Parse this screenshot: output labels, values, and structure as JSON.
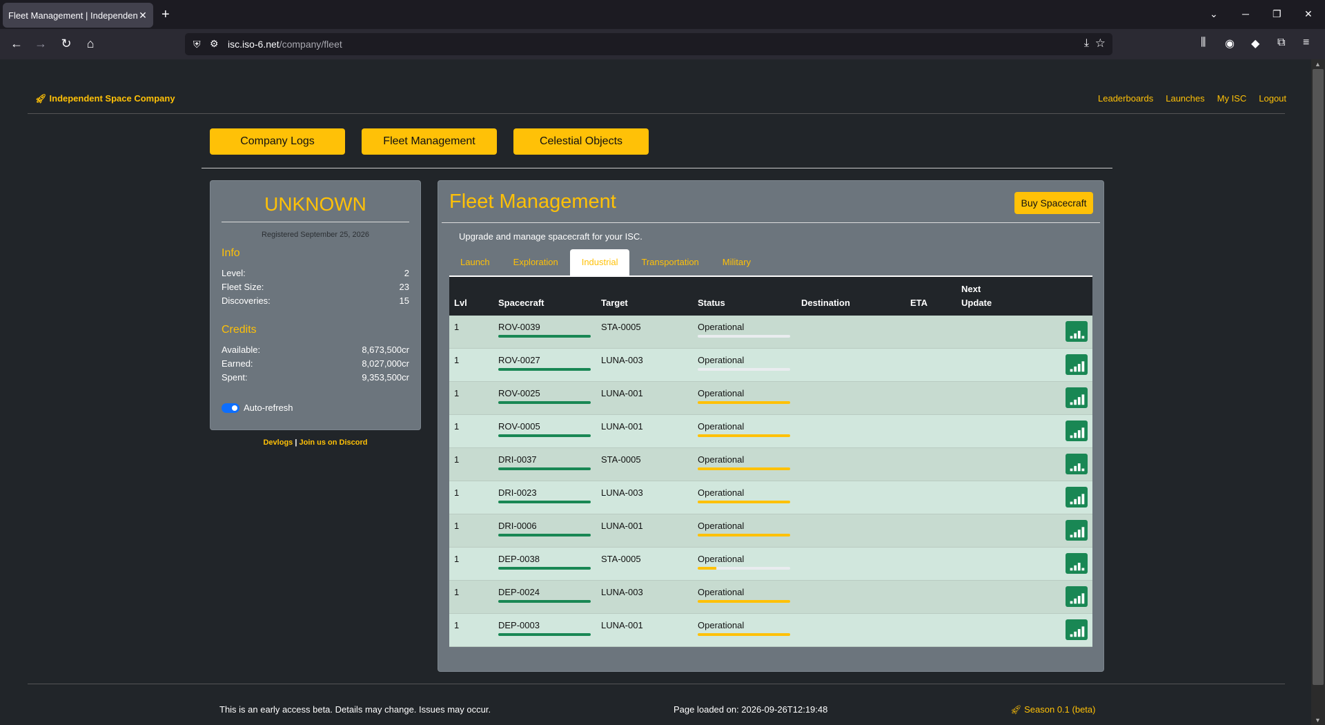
{
  "browser": {
    "tab_title": "Fleet Management | Independent Space Company",
    "tab_close": "✕",
    "new_tab": "+",
    "url_host": "isc.iso-6.net",
    "url_path": "/company/fleet"
  },
  "header": {
    "brand": "Independent Space Company",
    "nav": [
      "Leaderboards",
      "Launches",
      "My ISC",
      "Logout"
    ]
  },
  "section_nav": [
    "Company Logs",
    "Fleet Management",
    "Celestial Objects"
  ],
  "profile": {
    "name": "UNKNOWN",
    "registered": "Registered September 25, 2026",
    "info_title": "Info",
    "info": [
      {
        "label": "Level:",
        "value": "2"
      },
      {
        "label": "Fleet Size:",
        "value": "23"
      },
      {
        "label": "Discoveries:",
        "value": "15"
      }
    ],
    "credits_title": "Credits",
    "credits": [
      {
        "label": "Available:",
        "value": "8,673,500cr"
      },
      {
        "label": "Earned:",
        "value": "8,027,000cr"
      },
      {
        "label": "Spent:",
        "value": "9,353,500cr"
      }
    ],
    "auto_refresh_label": "Auto-refresh",
    "auto_refresh_on": true,
    "link_devlogs": "Devlogs",
    "link_sep": " | ",
    "link_discord": "Join us on Discord"
  },
  "fleet": {
    "title": "Fleet Management",
    "buy_label": "Buy Spacecraft",
    "description": "Upgrade and manage spacecraft for your ISC.",
    "tabs": [
      "Launch",
      "Exploration",
      "Industrial",
      "Transportation",
      "Military"
    ],
    "active_tab": "Industrial",
    "columns": {
      "lvl": "Lvl",
      "spacecraft": "Spacecraft",
      "target": "Target",
      "status": "Status",
      "destination": "Destination",
      "eta": "ETA",
      "next_update_1": "Next",
      "next_update_2": "Update"
    },
    "rows": [
      {
        "lvl": "1",
        "spacecraft": "ROV-0039",
        "target": "STA-0005",
        "status": "Operational",
        "progress": 0.0,
        "signal": "partial"
      },
      {
        "lvl": "1",
        "spacecraft": "ROV-0027",
        "target": "LUNA-003",
        "status": "Operational",
        "progress": 0.0,
        "signal": "full"
      },
      {
        "lvl": "1",
        "spacecraft": "ROV-0025",
        "target": "LUNA-001",
        "status": "Operational",
        "progress": 1.0,
        "signal": "full"
      },
      {
        "lvl": "1",
        "spacecraft": "ROV-0005",
        "target": "LUNA-001",
        "status": "Operational",
        "progress": 1.0,
        "signal": "full"
      },
      {
        "lvl": "1",
        "spacecraft": "DRI-0037",
        "target": "STA-0005",
        "status": "Operational",
        "progress": 1.0,
        "signal": "partial"
      },
      {
        "lvl": "1",
        "spacecraft": "DRI-0023",
        "target": "LUNA-003",
        "status": "Operational",
        "progress": 1.0,
        "signal": "full"
      },
      {
        "lvl": "1",
        "spacecraft": "DRI-0006",
        "target": "LUNA-001",
        "status": "Operational",
        "progress": 1.0,
        "signal": "full"
      },
      {
        "lvl": "1",
        "spacecraft": "DEP-0038",
        "target": "STA-0005",
        "status": "Operational",
        "progress": 0.2,
        "signal": "partial"
      },
      {
        "lvl": "1",
        "spacecraft": "DEP-0024",
        "target": "LUNA-003",
        "status": "Operational",
        "progress": 1.0,
        "signal": "full"
      },
      {
        "lvl": "1",
        "spacecraft": "DEP-0003",
        "target": "LUNA-001",
        "status": "Operational",
        "progress": 1.0,
        "signal": "full"
      }
    ]
  },
  "footer": {
    "notice": "This is an early access beta. Details may change. Issues may occur.",
    "loaded": "Page loaded on: 2026-09-26T12:19:48",
    "season": "Season 0.1 (beta)"
  },
  "colors": {
    "accent": "#ffc107",
    "success": "#198754",
    "panel": "#6c757d",
    "background": "#212529"
  }
}
